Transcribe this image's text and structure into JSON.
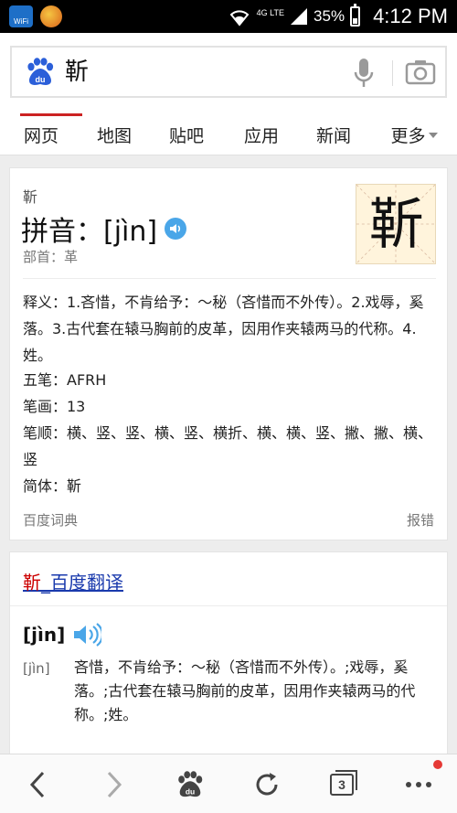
{
  "status_bar": {
    "lte": "4G LTE",
    "battery": "35%",
    "battery_level": 0.35,
    "time": "4:12 PM",
    "wifi_app_label": "WiFi"
  },
  "search": {
    "query": "靳",
    "logo_text": "du"
  },
  "tabs": [
    {
      "label": "网页",
      "active": true
    },
    {
      "label": "地图",
      "active": false
    },
    {
      "label": "贴吧",
      "active": false
    },
    {
      "label": "应用",
      "active": false
    },
    {
      "label": "新闻",
      "active": false
    },
    {
      "label": "更多",
      "active": false
    }
  ],
  "dictionary": {
    "char": "靳",
    "pinyin_label": "拼音：[jìn]",
    "radical": "部首：革",
    "image_char": "靳",
    "definition": "释义：1.吝惜，不肯给予：～秘（吝惜而不外传）。2.戏辱，奚落。3.古代套在辕马胸前的皮革，因用作夹辕两马的代称。4.姓。",
    "wubi": "五笔：AFRH",
    "strokes": "笔画：13",
    "stroke_order": "笔顺：横、竖、竖、横、竖、横折、横、横、竖、撇、撇、横、竖",
    "simplified": "简体：靳",
    "source": "百度词典",
    "report": "报错"
  },
  "translate": {
    "title_char": "靳",
    "title_rest": "_百度翻译",
    "pinyin_bracket": "[jìn]",
    "pinyin_small": "[jìn]",
    "definition": "吝惜，不肯给予：～秘（吝惜而不外传）。;戏辱，奚落。;古代套在辕马胸前的皮革，因用作夹辕两马的代称。;姓。"
  },
  "bottom_nav": {
    "tab_count": "3"
  },
  "colors": {
    "accent_red": "#cc2222",
    "link_blue": "#1a3aad",
    "speaker_blue": "#4aa6e8",
    "baidu_blue": "#2b5fd9"
  }
}
